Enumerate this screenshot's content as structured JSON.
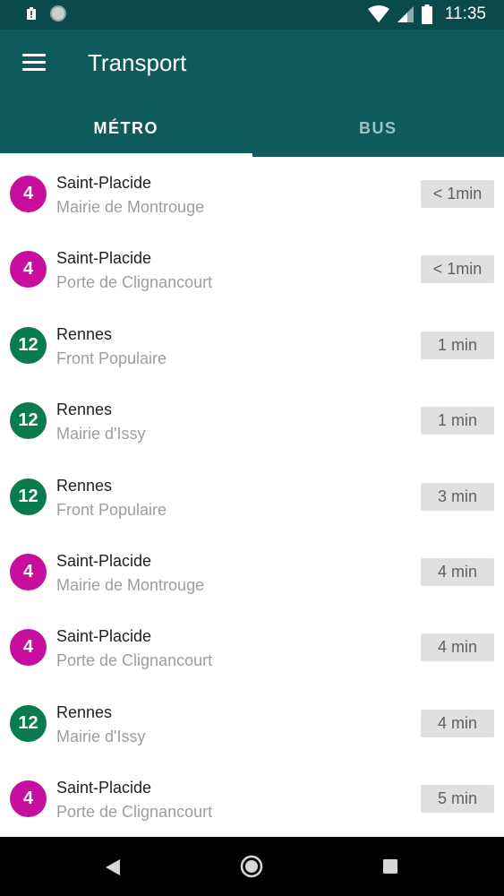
{
  "status_bar": {
    "time": "11:35"
  },
  "app_bar": {
    "title": "Transport"
  },
  "tabs": [
    {
      "label": "MÉTRO",
      "active": true
    },
    {
      "label": "BUS",
      "active": false
    }
  ],
  "colors": {
    "line_4": "#c6109d",
    "line_12": "#0a7a4f",
    "app_bar": "#0e5a5c",
    "status_bar": "#0a4a4c"
  },
  "departures": [
    {
      "line": "4",
      "stop": "Saint-Placide",
      "destination": "Mairie de Montrouge",
      "time": "< 1min"
    },
    {
      "line": "4",
      "stop": "Saint-Placide",
      "destination": "Porte de Clignancourt",
      "time": "< 1min"
    },
    {
      "line": "12",
      "stop": "Rennes",
      "destination": "Front Populaire",
      "time": "1 min"
    },
    {
      "line": "12",
      "stop": "Rennes",
      "destination": "Mairie d'Issy",
      "time": "1 min"
    },
    {
      "line": "12",
      "stop": "Rennes",
      "destination": "Front Populaire",
      "time": "3 min"
    },
    {
      "line": "4",
      "stop": "Saint-Placide",
      "destination": "Mairie de Montrouge",
      "time": "4 min"
    },
    {
      "line": "4",
      "stop": "Saint-Placide",
      "destination": "Porte de Clignancourt",
      "time": "4 min"
    },
    {
      "line": "12",
      "stop": "Rennes",
      "destination": "Mairie d'Issy",
      "time": "4 min"
    },
    {
      "line": "4",
      "stop": "Saint-Placide",
      "destination": "Porte de Clignancourt",
      "time": "5 min"
    }
  ]
}
